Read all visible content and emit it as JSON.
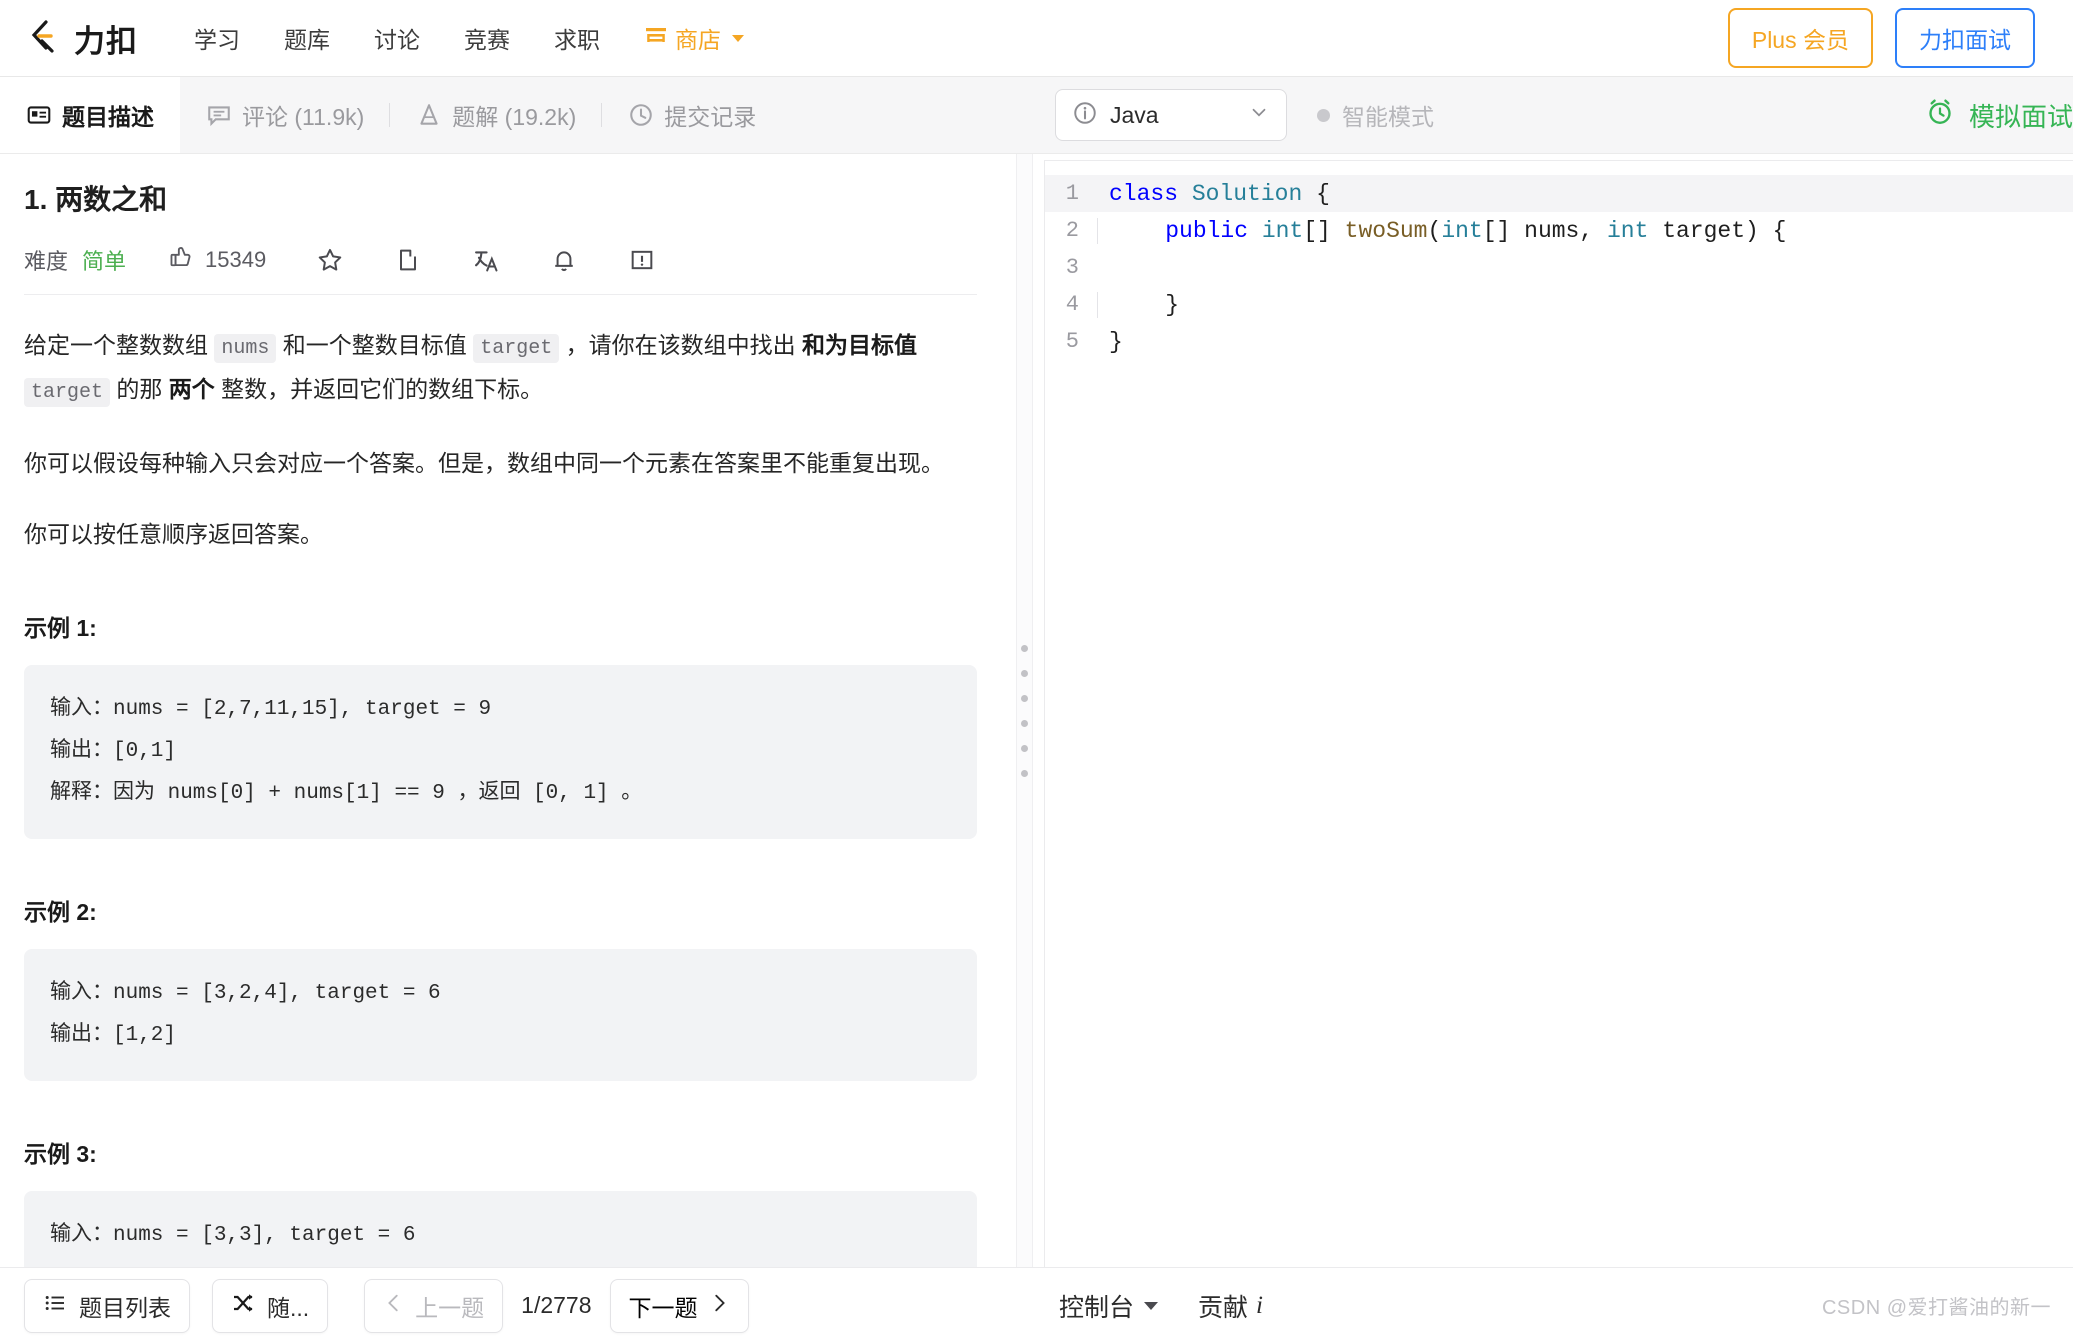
{
  "navbar": {
    "brand": "力扣",
    "brand_logo_icon": "leetcode-logo-icon",
    "links": [
      {
        "label": "学习",
        "name": "nav-link-study"
      },
      {
        "label": "题库",
        "name": "nav-link-problems"
      },
      {
        "label": "讨论",
        "name": "nav-link-discuss"
      },
      {
        "label": "竞赛",
        "name": "nav-link-contest"
      },
      {
        "label": "求职",
        "name": "nav-link-jobs"
      }
    ],
    "shop": {
      "label": "商店",
      "icon": "store-icon",
      "caret": "chevron-down-icon"
    },
    "plus_button": "Plus 会员",
    "interview_button": "力扣面试",
    "accent_orange": "#f5a623",
    "accent_blue": "#2d7ff9"
  },
  "tabs": [
    {
      "label": "题目描述",
      "icon": "description-icon",
      "active": true,
      "name": "tab-description"
    },
    {
      "label": "评论 (11.9k)",
      "icon": "comment-icon",
      "active": false,
      "name": "tab-comments"
    },
    {
      "label": "题解 (19.2k)",
      "icon": "flask-icon",
      "active": false,
      "name": "tab-solutions"
    },
    {
      "label": "提交记录",
      "icon": "clock-icon",
      "active": false,
      "name": "tab-submissions"
    }
  ],
  "editor_header": {
    "language": "Java",
    "language_info_icon": "info-circle-icon",
    "language_chevron": "chevron-down-icon",
    "smart_mode": "智能模式",
    "smart_mode_toggle_icon": "toggle-dot-icon",
    "mock_interview": "模拟面试",
    "mock_interview_icon": "alarm-clock-icon",
    "mock_interview_color": "#36b555"
  },
  "problem": {
    "title": "1. 两数之和",
    "difficulty_label": "难度",
    "difficulty": "简单",
    "difficulty_color": "#4caf50",
    "likes": "15349",
    "likes_icon": "thumbs-up-icon",
    "action_icons": [
      "star-icon",
      "share-icon",
      "translate-icon",
      "bell-icon",
      "report-icon"
    ],
    "paragraph1": {
      "t1": "给定一个整数数组 ",
      "c1": "nums",
      "t2": " 和一个整数目标值 ",
      "c2": "target",
      "t3": " ，请你在该数组中找出 ",
      "b1": "和为目标值",
      "c3": "target",
      "t4": " 的那 ",
      "b2": "两个",
      "t5": " 整数，并返回它们的数组下标。"
    },
    "paragraph2": "你可以假设每种输入只会对应一个答案。但是，数组中同一个元素在答案里不能重复出现。",
    "paragraph3": "你可以按任意顺序返回答案。",
    "examples": [
      {
        "title": "示例 1:",
        "body": "输入：nums = [2,7,11,15], target = 9\n输出：[0,1]\n解释：因为 nums[0] + nums[1] == 9 ，返回 [0, 1] 。"
      },
      {
        "title": "示例 2:",
        "body": "输入：nums = [3,2,4], target = 6\n输出：[1,2]"
      },
      {
        "title": "示例 3:",
        "body": "输入：nums = [3,3], target = 6"
      }
    ]
  },
  "code": {
    "lines": [
      {
        "num": "1",
        "indent": false,
        "tokens": [
          {
            "t": "class ",
            "c": "kw"
          },
          {
            "t": "Solution ",
            "c": "type"
          },
          {
            "t": "{",
            "c": "id"
          }
        ]
      },
      {
        "num": "2",
        "indent": true,
        "tokens": [
          {
            "t": "    public ",
            "c": "kw"
          },
          {
            "t": "int",
            "c": "type"
          },
          {
            "t": "[] ",
            "c": "id"
          },
          {
            "t": "twoSum",
            "c": "fn"
          },
          {
            "t": "(",
            "c": "id"
          },
          {
            "t": "int",
            "c": "type"
          },
          {
            "t": "[] nums, ",
            "c": "id"
          },
          {
            "t": "int",
            "c": "type"
          },
          {
            "t": " target) {",
            "c": "id"
          }
        ]
      },
      {
        "num": "3",
        "indent": true,
        "tokens": [
          {
            "t": "",
            "c": "id"
          }
        ]
      },
      {
        "num": "4",
        "indent": true,
        "tokens": [
          {
            "t": "    }",
            "c": "id"
          }
        ]
      },
      {
        "num": "5",
        "indent": false,
        "tokens": [
          {
            "t": "}",
            "c": "id"
          }
        ]
      }
    ]
  },
  "bottom": {
    "problem_list": "题目列表",
    "problem_list_icon": "list-icon",
    "random": "随...",
    "random_icon": "shuffle-icon",
    "prev": "上一题",
    "prev_icon": "chevron-left-icon",
    "counter": "1/2778",
    "next": "下一题",
    "next_icon": "chevron-right-icon",
    "console": "控制台",
    "console_caret_icon": "caret-down-icon",
    "contribute": "贡献",
    "contribute_icon": "italic-i-icon",
    "watermark": "CSDN @爱打酱油的新一"
  }
}
